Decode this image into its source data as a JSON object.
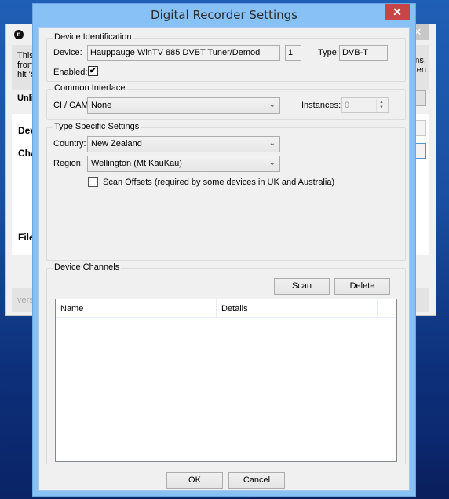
{
  "background_window": {
    "app_icon": "n",
    "intro_lines_left": [
      "This a",
      "from c",
      "hit 'St"
    ],
    "intro_lines_right": [
      "ms,",
      "hen"
    ],
    "section_title": "Unlic",
    "labels": [
      "Devi",
      "Cha",
      "File"
    ],
    "footer": "versic",
    "close_glyph": "✕"
  },
  "dialog": {
    "title": "Digital Recorder Settings",
    "close_glyph": "✕",
    "device_identification": {
      "title": "Device Identification",
      "device_label": "Device:",
      "device_value": "Hauppauge WinTV 885 DVBT Tuner/Demod",
      "index_value": "1",
      "type_label": "Type:",
      "type_value": "DVB-T",
      "enabled_label": "Enabled:",
      "enabled_checked": true,
      "check_glyph": "✔"
    },
    "common_interface": {
      "title": "Common Interface",
      "cicam_label": "CI / CAM:",
      "cicam_value": "None",
      "instances_label": "Instances:",
      "instances_value": "0"
    },
    "type_specific": {
      "title": "Type Specific Settings",
      "country_label": "Country:",
      "country_value": "New Zealand",
      "region_label": "Region:",
      "region_value": "Wellington (Mt KauKau)",
      "scan_offsets_label": "Scan Offsets (required by some devices in UK and Australia)",
      "scan_offsets_checked": false
    },
    "device_channels": {
      "title": "Device Channels",
      "scan_button": "Scan",
      "delete_button": "Delete",
      "columns": [
        "Name",
        "Details"
      ],
      "rows": []
    },
    "ok_button": "OK",
    "cancel_button": "Cancel"
  },
  "icons": {
    "dropdown_arrow": "⌄",
    "spin_up": "▲",
    "spin_down": "▼"
  },
  "colors": {
    "dialog_frame": "#88c1f6",
    "close_button": "#c74546",
    "client_bg": "#f0f0f0"
  }
}
